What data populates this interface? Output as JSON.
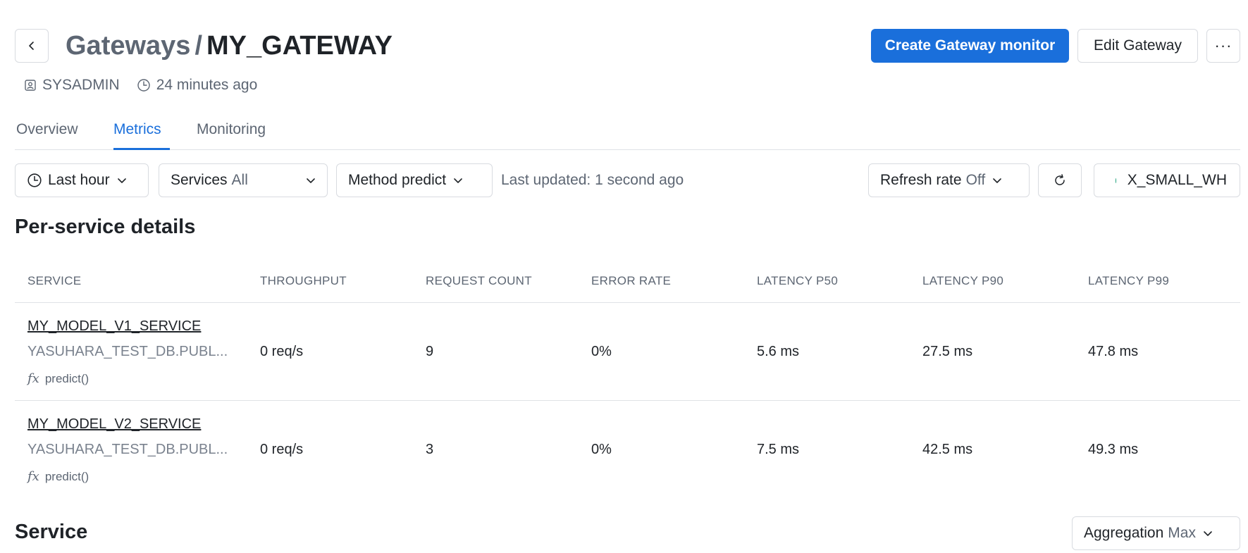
{
  "header": {
    "breadcrumb_parent": "Gateways",
    "separator": "/",
    "title": "MY_GATEWAY",
    "create_monitor_label": "Create Gateway monitor",
    "edit_label": "Edit Gateway",
    "more_label": "···"
  },
  "meta": {
    "owner": "SYSADMIN",
    "updated": "24 minutes ago"
  },
  "tabs": [
    {
      "label": "Overview",
      "active": false
    },
    {
      "label": "Metrics",
      "active": true
    },
    {
      "label": "Monitoring",
      "active": false
    }
  ],
  "filters": {
    "time_range": "Last hour",
    "services_label": "Services",
    "services_value": "All",
    "method_label": "Method",
    "method_value": "predict",
    "last_updated": "Last updated: 1 second ago",
    "refresh_label": "Refresh rate",
    "refresh_value": "Off",
    "warehouse": "X_SMALL_WH"
  },
  "per_service": {
    "title": "Per-service details",
    "columns": [
      "SERVICE",
      "THROUGHPUT",
      "REQUEST COUNT",
      "ERROR RATE",
      "LATENCY P50",
      "LATENCY P90",
      "LATENCY P99"
    ],
    "rows": [
      {
        "name": "MY_MODEL_V1_SERVICE",
        "path": "YASUHARA_TEST_DB.PUBL...",
        "method": "predict()",
        "throughput": "0 req/s",
        "request_count": "9",
        "error_rate": "0%",
        "p50": "5.6 ms",
        "p90": "27.5 ms",
        "p99": "47.8 ms"
      },
      {
        "name": "MY_MODEL_V2_SERVICE",
        "path": "YASUHARA_TEST_DB.PUBL...",
        "method": "predict()",
        "throughput": "0 req/s",
        "request_count": "3",
        "error_rate": "0%",
        "p50": "7.5 ms",
        "p90": "42.5 ms",
        "p99": "49.3 ms"
      }
    ]
  },
  "service_section": {
    "title": "Service",
    "aggregation_label": "Aggregation",
    "aggregation_value": "Max"
  },
  "colors": {
    "accent": "#1a6fdb",
    "status_ok": "#1aa07a"
  },
  "icons": {
    "back": "chevron-left-icon",
    "owner": "user-badge-icon",
    "time": "clock-icon",
    "dropdown": "chevron-down-icon",
    "refresh": "refresh-icon",
    "function": "function-icon"
  }
}
